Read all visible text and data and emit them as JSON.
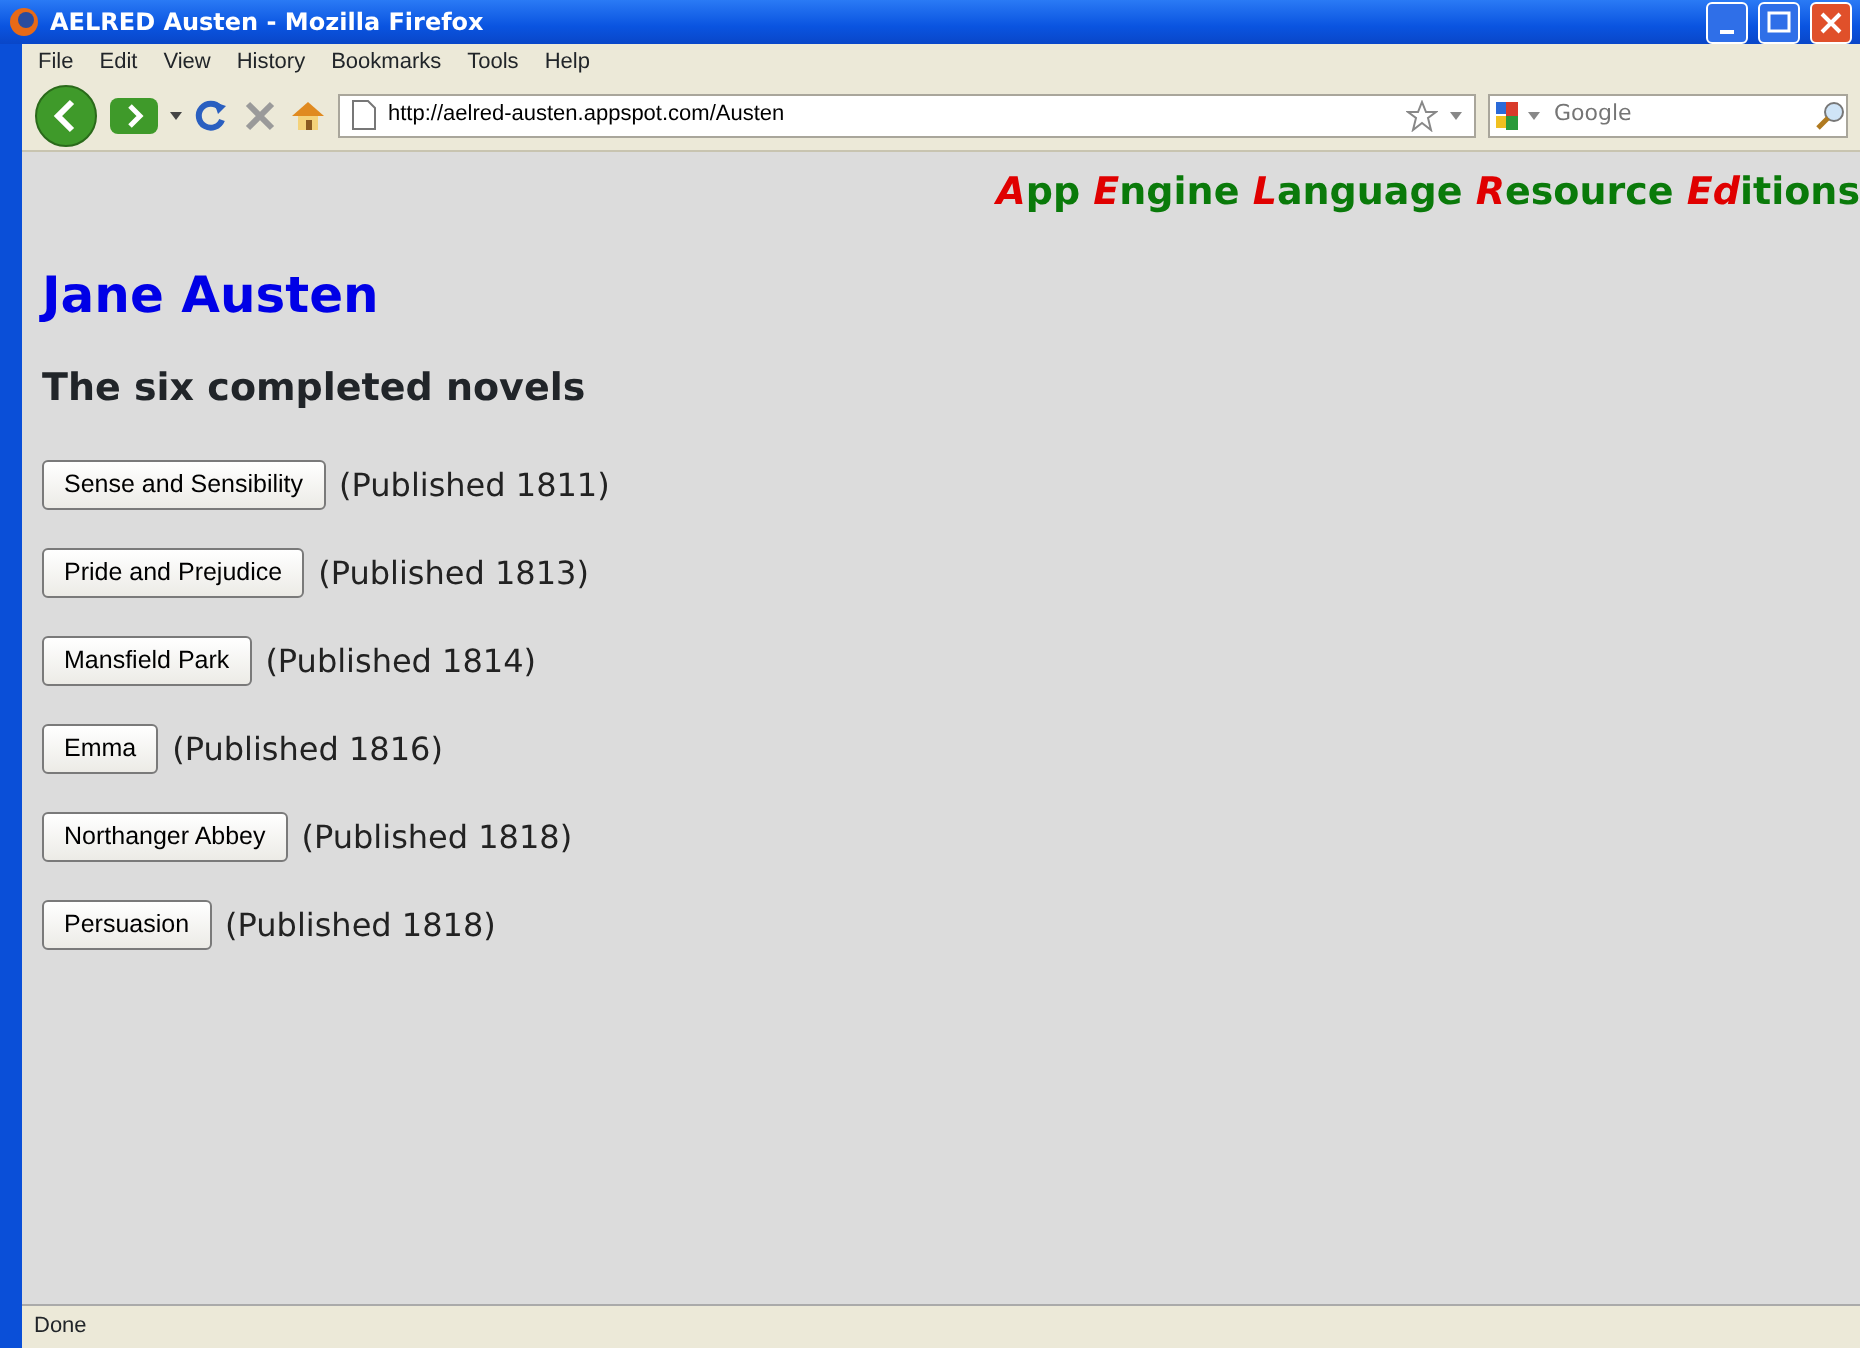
{
  "window": {
    "title": "AELRED Austen - Mozilla Firefox"
  },
  "menu": [
    "File",
    "Edit",
    "View",
    "History",
    "Bookmarks",
    "Tools",
    "Help"
  ],
  "address_bar": {
    "value": "http://aelred-austen.appspot.com/Austen"
  },
  "search": {
    "placeholder": "Google"
  },
  "banner": [
    {
      "text": "A",
      "highlight": true
    },
    {
      "text": "pp ",
      "highlight": false
    },
    {
      "text": "E",
      "highlight": true
    },
    {
      "text": "ngine ",
      "highlight": false
    },
    {
      "text": "L",
      "highlight": true
    },
    {
      "text": "anguage ",
      "highlight": false
    },
    {
      "text": "R",
      "highlight": true
    },
    {
      "text": "esource ",
      "highlight": false
    },
    {
      "text": "Ed",
      "highlight": true
    },
    {
      "text": "itions",
      "highlight": false
    }
  ],
  "heading": "Jane Austen",
  "subheading": "The six completed novels",
  "novels": [
    {
      "title": "Sense and Sensibility",
      "published": "(Published 1811)"
    },
    {
      "title": "Pride and Prejudice",
      "published": "(Published 1813)"
    },
    {
      "title": "Mansfield Park",
      "published": "(Published 1814)"
    },
    {
      "title": "Emma",
      "published": "(Published 1816)"
    },
    {
      "title": "Northanger Abbey",
      "published": "(Published 1818)"
    },
    {
      "title": "Persuasion",
      "published": "(Published 1818)"
    }
  ],
  "status_bar": "Done"
}
